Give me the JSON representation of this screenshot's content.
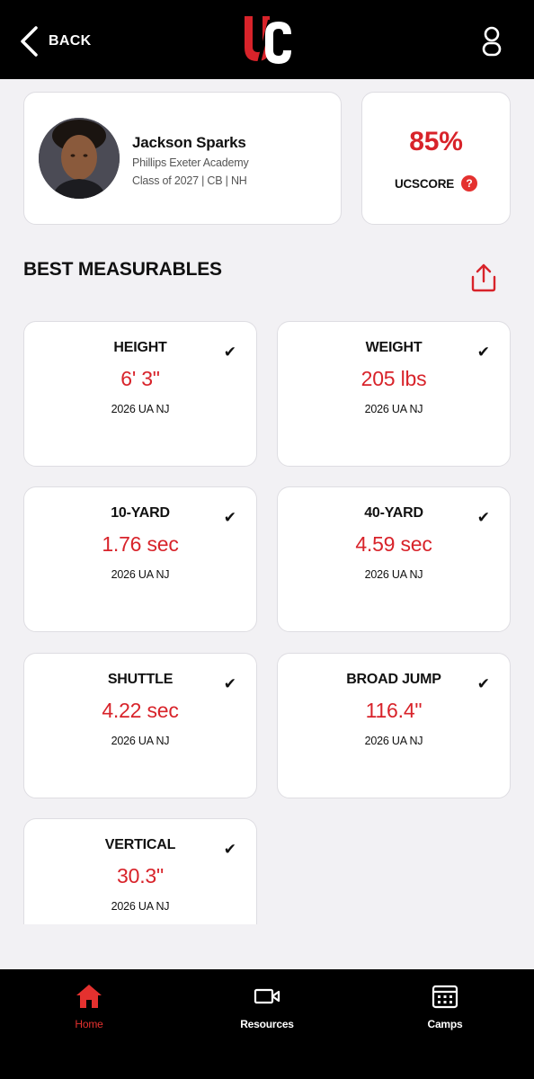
{
  "header": {
    "back_label": "BACK",
    "logo_text": "UC"
  },
  "profile": {
    "name": "Jackson Sparks",
    "school": "Phillips Exeter Academy",
    "class_info": "Class of 2027 | CB | NH"
  },
  "score": {
    "value": "85%",
    "label": "UCSCORE",
    "help_symbol": "?"
  },
  "section": {
    "title": "BEST MEASURABLES"
  },
  "measurables": [
    {
      "title": "HEIGHT",
      "value": "6' 3\"",
      "event": "2026 UA NJ",
      "check": "✔"
    },
    {
      "title": "WEIGHT",
      "value": "205 lbs",
      "event": "2026 UA NJ",
      "check": "✔"
    },
    {
      "title": "10-YARD",
      "value": "1.76 sec",
      "event": "2026 UA NJ",
      "check": "✔"
    },
    {
      "title": "40-YARD",
      "value": "4.59 sec",
      "event": "2026 UA NJ",
      "check": "✔"
    },
    {
      "title": "SHUTTLE",
      "value": "4.22 sec",
      "event": "2026 UA NJ",
      "check": "✔"
    },
    {
      "title": "BROAD JUMP",
      "value": "116.4\"",
      "event": "2026 UA NJ",
      "check": "✔"
    },
    {
      "title": "VERTICAL",
      "value": "30.3\"",
      "event": "2026 UA NJ",
      "check": "✔"
    }
  ],
  "nav": {
    "items": [
      {
        "label": "Home",
        "icon": "home-icon",
        "active": true
      },
      {
        "label": "Resources",
        "icon": "video-icon",
        "active": false
      },
      {
        "label": "Camps",
        "icon": "calendar-icon",
        "active": false
      }
    ]
  },
  "colors": {
    "accent": "#d8232a",
    "header_bg": "#000000",
    "page_bg": "#f2f1f4"
  }
}
